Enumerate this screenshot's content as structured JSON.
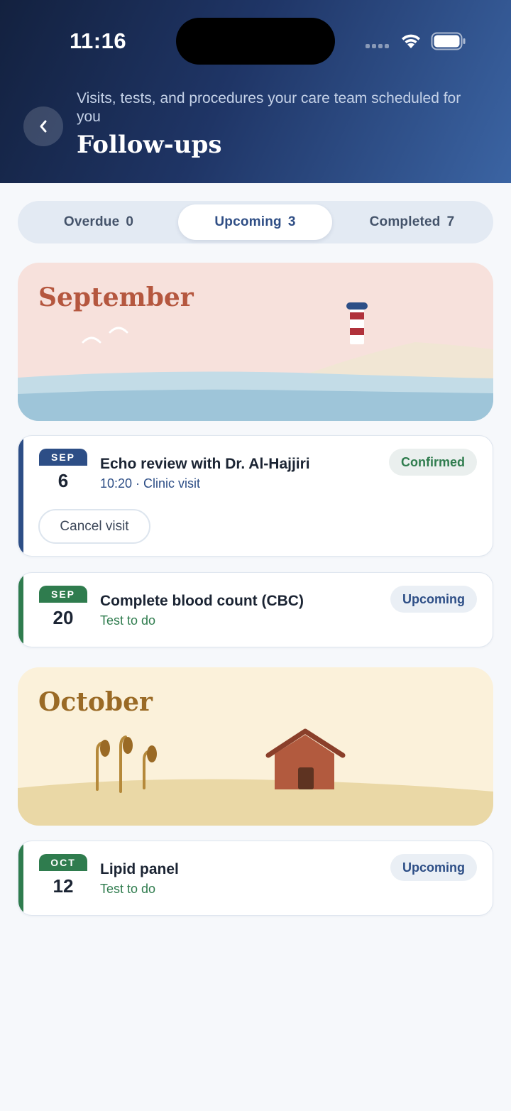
{
  "status_bar": {
    "time": "11:16"
  },
  "header": {
    "subtitle": "Visits, tests, and procedures your care team scheduled for you",
    "title": "Follow-ups"
  },
  "tabs": [
    {
      "label": "Overdue",
      "count": "0",
      "active": false
    },
    {
      "label": "Upcoming",
      "count": "3",
      "active": true
    },
    {
      "label": "Completed",
      "count": "7",
      "active": false
    }
  ],
  "months": [
    {
      "name": "September",
      "color": "#b5573f"
    },
    {
      "name": "October",
      "color": "#9a6a25"
    }
  ],
  "items": [
    {
      "month": "SEP",
      "day": "6",
      "title": "Echo review with Dr. Al-Hajjiri",
      "subtitle": "10:20 · Clinic visit",
      "status": "Confirmed",
      "action": "Cancel visit",
      "accent": "#2d4e86"
    },
    {
      "month": "SEP",
      "day": "20",
      "title": "Complete blood count (CBC)",
      "subtitle": "Test to do",
      "status": "Upcoming",
      "accent": "#2f7c4e"
    },
    {
      "month": "OCT",
      "day": "12",
      "title": "Lipid panel",
      "subtitle": "Test to do",
      "status": "Upcoming",
      "accent": "#2f7c4e"
    }
  ],
  "colors": {
    "confirmed_text": "#2f7c4e",
    "confirmed_bg": "#eaefee",
    "upcoming_text": "#2d4e86",
    "upcoming_bg": "#eaeff5"
  }
}
